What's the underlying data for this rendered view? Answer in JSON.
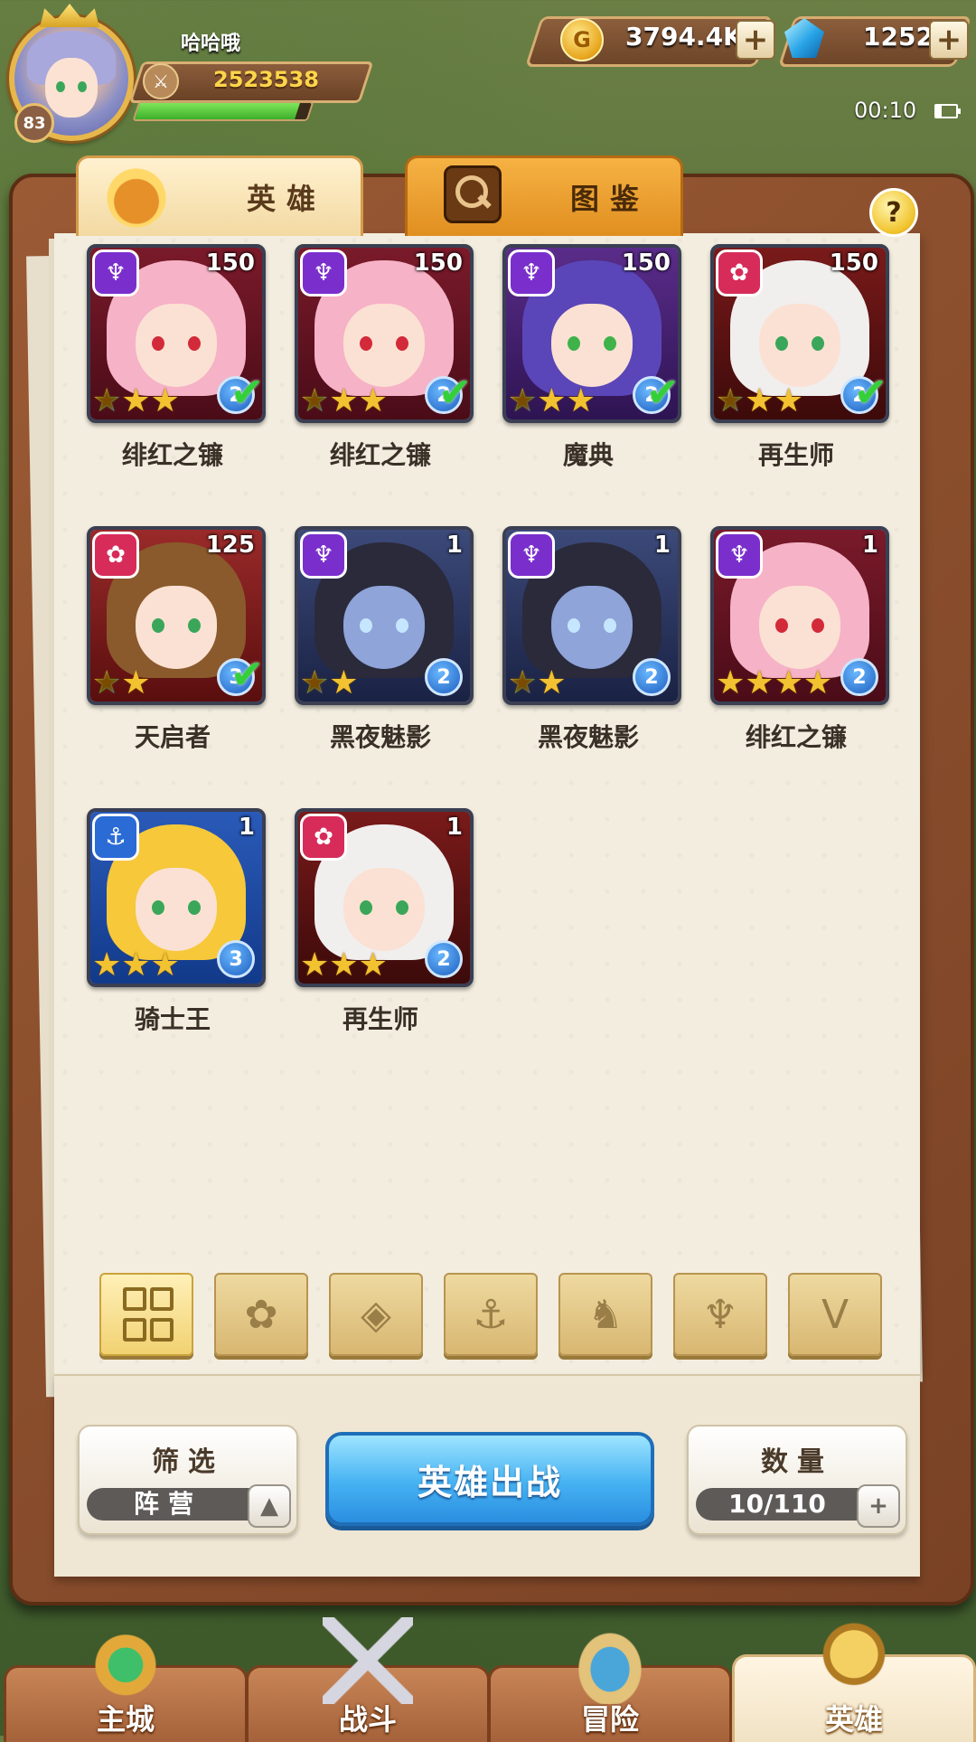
{
  "player": {
    "name": "哈哈哦",
    "level": "83",
    "power": "2523538",
    "xp_fraction": 0.93
  },
  "resources": {
    "gold": "3794.4K",
    "gems": "1252",
    "plus": "+"
  },
  "status": {
    "time": "00:10"
  },
  "tabs": [
    {
      "label": "英雄",
      "active": true
    },
    {
      "label": "图鉴",
      "active": false
    }
  ],
  "help": "?",
  "heroes": [
    {
      "name": "绯红之镰",
      "level": "150",
      "faction": "dark",
      "stars": 2,
      "rainbow_stars": 1,
      "grade": "2",
      "deployed": true
    },
    {
      "name": "绯红之镰",
      "level": "150",
      "faction": "dark",
      "stars": 2,
      "rainbow_stars": 1,
      "grade": "2",
      "deployed": true
    },
    {
      "name": "魔典",
      "level": "150",
      "faction": "dark",
      "stars": 2,
      "rainbow_stars": 1,
      "grade": "2",
      "deployed": true
    },
    {
      "name": "再生师",
      "level": "150",
      "faction": "fire",
      "stars": 2,
      "rainbow_stars": 1,
      "grade": "2",
      "deployed": true
    },
    {
      "name": "天启者",
      "level": "125",
      "faction": "fire",
      "stars": 1,
      "rainbow_stars": 1,
      "grade": "3",
      "deployed": true
    },
    {
      "name": "黑夜魅影",
      "level": "1",
      "faction": "dark",
      "stars": 1,
      "rainbow_stars": 1,
      "grade": "2",
      "deployed": false
    },
    {
      "name": "黑夜魅影",
      "level": "1",
      "faction": "dark",
      "stars": 1,
      "rainbow_stars": 1,
      "grade": "2",
      "deployed": false
    },
    {
      "name": "绯红之镰",
      "level": "1",
      "faction": "dark",
      "stars": 4,
      "rainbow_stars": 0,
      "grade": "2",
      "deployed": false
    },
    {
      "name": "骑士王",
      "level": "1",
      "faction": "water",
      "stars": 3,
      "rainbow_stars": 0,
      "grade": "3",
      "deployed": false
    },
    {
      "name": "再生师",
      "level": "1",
      "faction": "fire",
      "stars": 3,
      "rainbow_stars": 0,
      "grade": "2",
      "deployed": false
    }
  ],
  "faction_filters": [
    {
      "icon": "all-grid-icon",
      "active": true
    },
    {
      "icon": "flame-faction-icon",
      "active": false
    },
    {
      "icon": "diamond-faction-icon",
      "active": false
    },
    {
      "icon": "anchor-faction-icon",
      "active": false
    },
    {
      "icon": "beast-faction-icon",
      "active": false
    },
    {
      "icon": "horns-faction-icon",
      "active": false
    },
    {
      "icon": "wings-faction-icon",
      "active": false
    }
  ],
  "controls": {
    "filter_title": "筛选",
    "filter_value": "阵营",
    "deploy_label": "英雄出战",
    "count_title": "数量",
    "count_value": "10/110"
  },
  "nav": [
    {
      "label": "主城",
      "icon": "castle-icon",
      "active": false
    },
    {
      "label": "战斗",
      "icon": "crossed-swords-icon",
      "active": false
    },
    {
      "label": "冒险",
      "icon": "map-icon",
      "active": false
    },
    {
      "label": "英雄",
      "icon": "hero-helmet-icon",
      "active": true
    }
  ]
}
